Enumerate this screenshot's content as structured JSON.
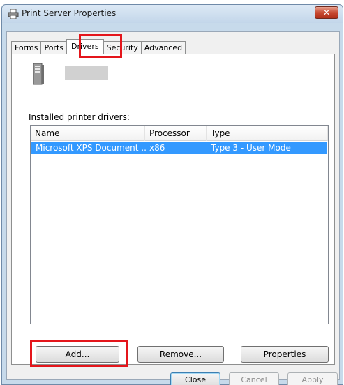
{
  "window": {
    "title": "Print Server Properties",
    "close_symbol": "✕"
  },
  "tabs": [
    {
      "label": "Forms",
      "active": false
    },
    {
      "label": "Ports",
      "active": false
    },
    {
      "label": "Drivers",
      "active": true
    },
    {
      "label": "Security",
      "active": false
    },
    {
      "label": "Advanced",
      "active": false
    }
  ],
  "drivers": {
    "installed_label": "Installed printer drivers:",
    "columns": [
      "Name",
      "Processor",
      "Type"
    ],
    "rows": [
      {
        "name": "Microsoft XPS Document ...",
        "processor": "x86",
        "type": "Type 3 - User Mode",
        "selected": true
      }
    ],
    "add_label": "Add...",
    "remove_label": "Remove...",
    "properties_label": "Properties"
  },
  "footer": {
    "close_label": "Close",
    "cancel_label": "Cancel",
    "apply_label": "Apply"
  },
  "colors": {
    "highlight": "#e4151b",
    "selection": "#3399ff"
  },
  "icons": [
    "printer-icon",
    "server-icon"
  ]
}
